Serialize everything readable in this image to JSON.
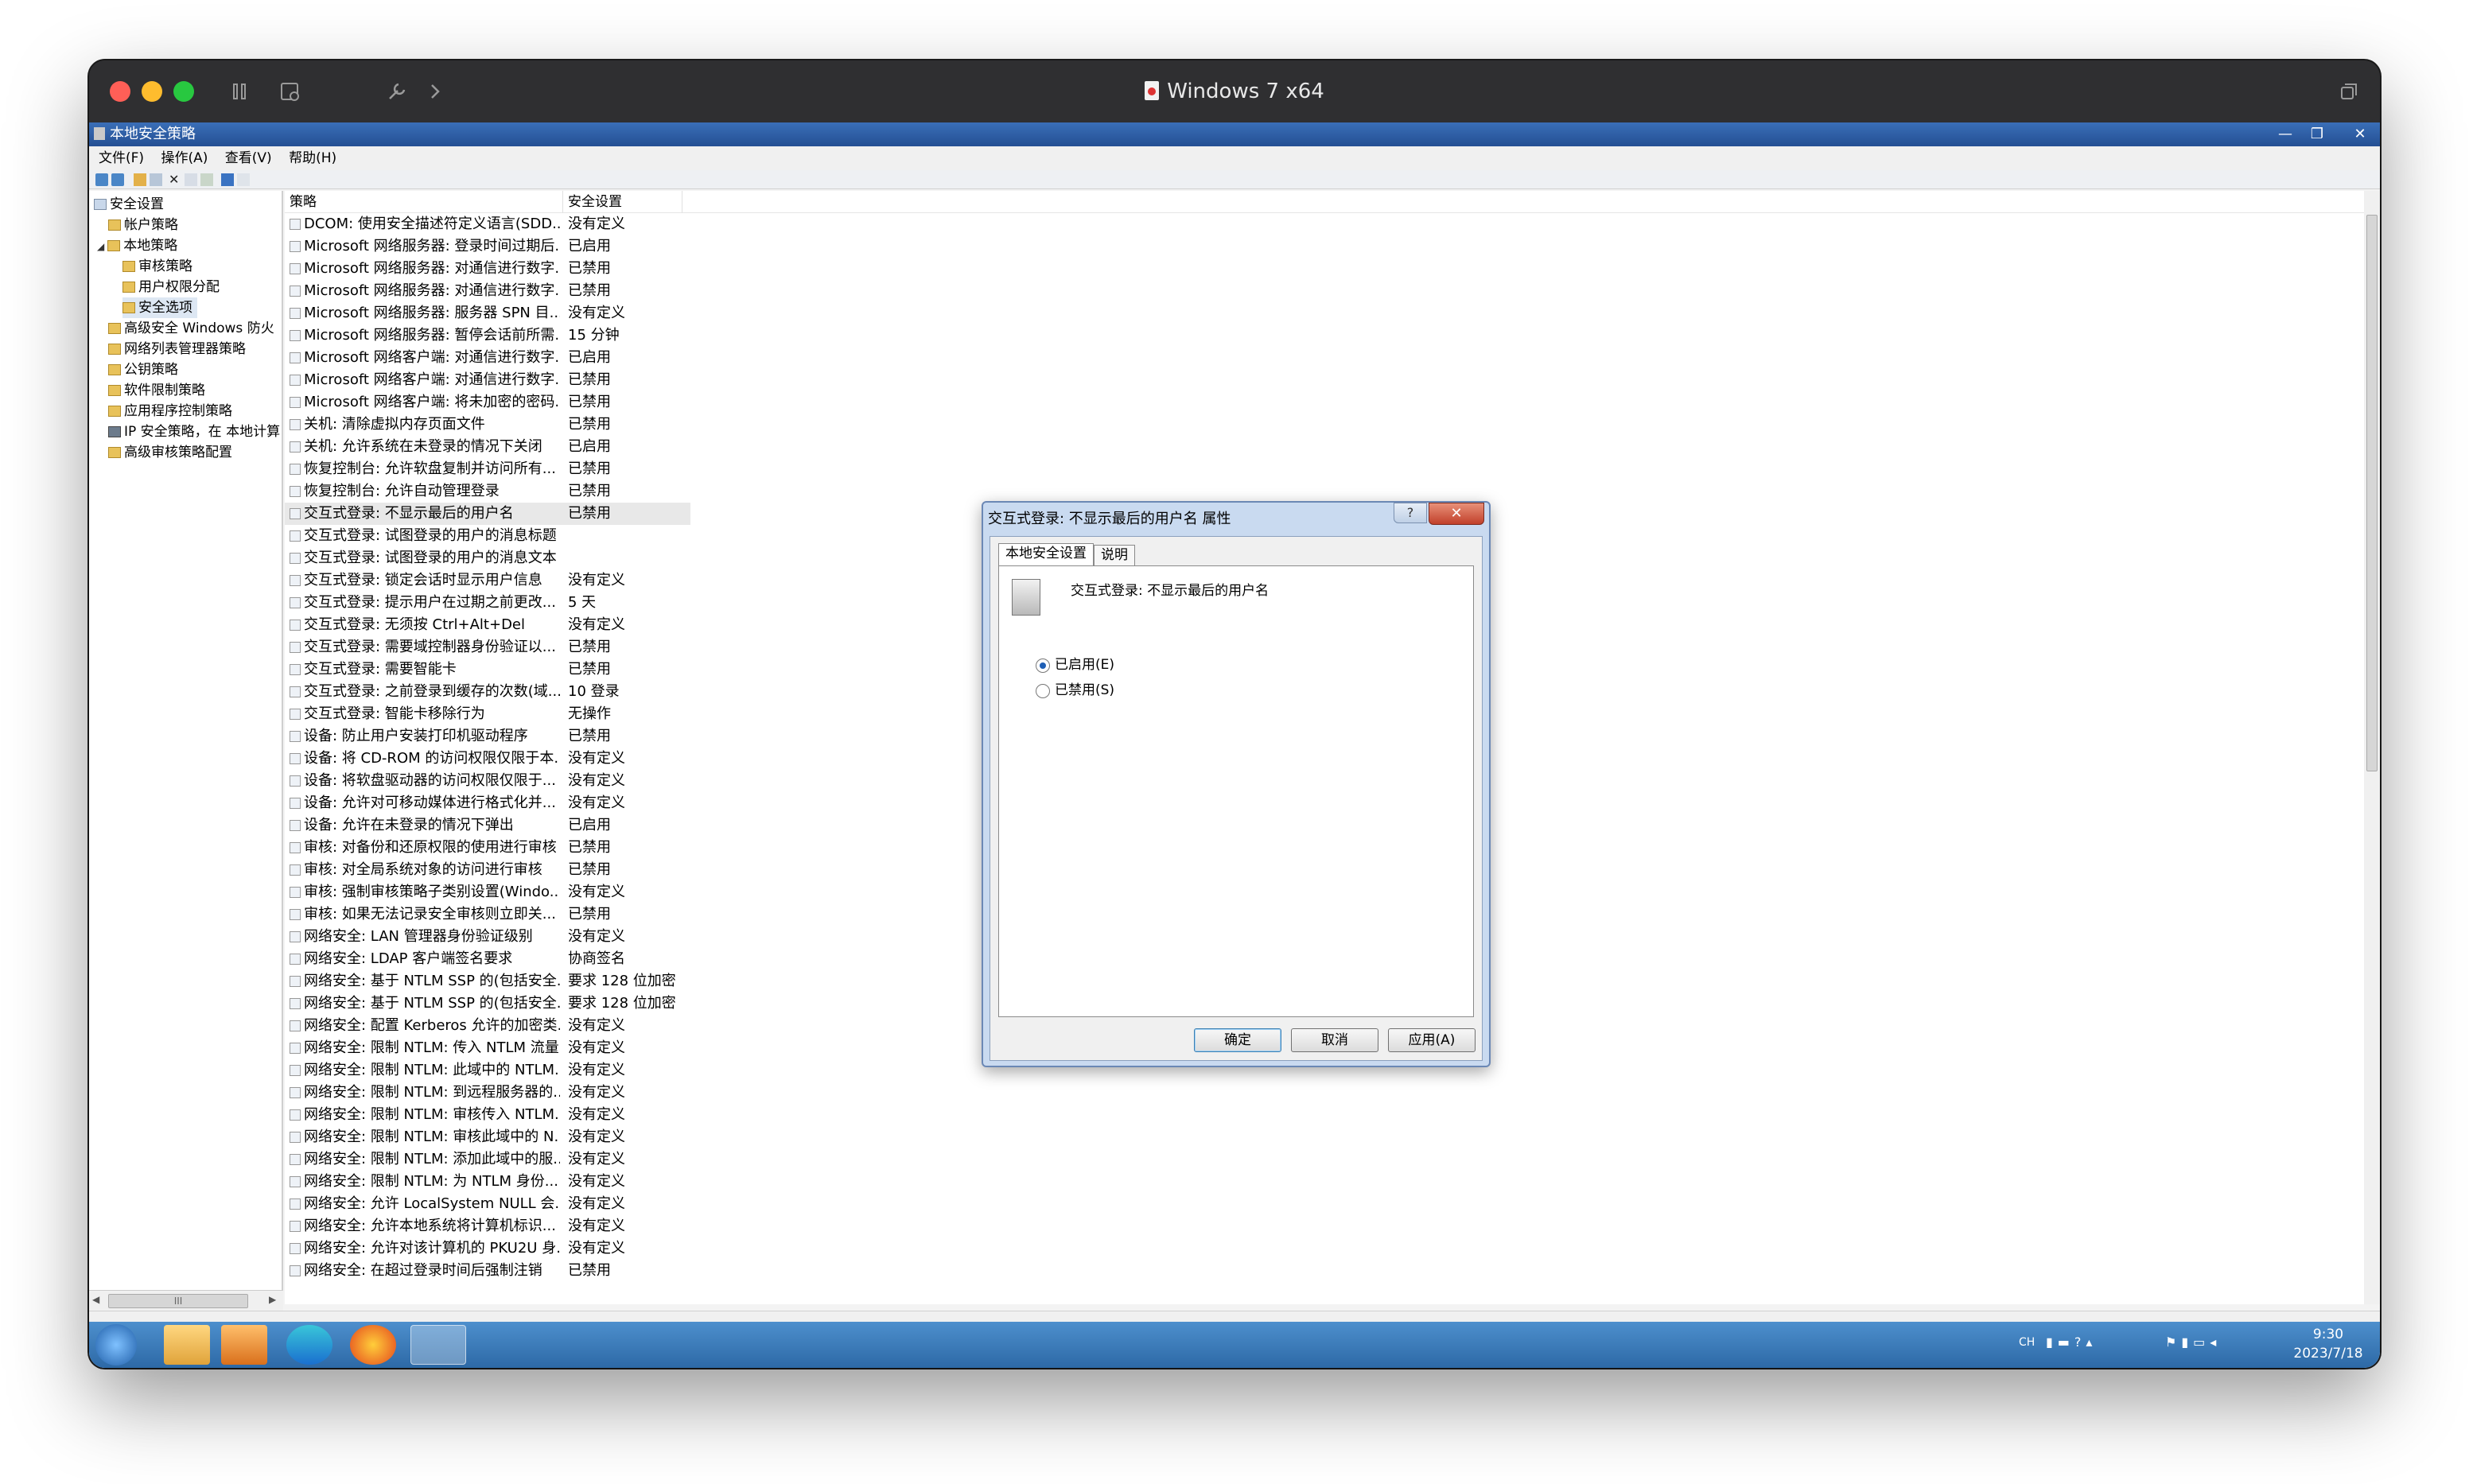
{
  "mac_window": {
    "title": "Windows 7 x64",
    "traffic_colors": {
      "close": "#ff5f57",
      "minimize": "#febc2e",
      "maximize": "#28c840"
    },
    "toolbar_icons": [
      "pause-icon",
      "snapshot-icon",
      "wrench-icon",
      "chevron-right-icon"
    ],
    "restore_icon": "restore-window-icon"
  },
  "app": {
    "title": "本地安全策略",
    "menu": [
      "文件(F)",
      "操作(A)",
      "查看(V)",
      "帮助(H)"
    ],
    "caption_buttons": {
      "minimize": "—",
      "restore": "❐",
      "close": "✕"
    }
  },
  "tree": {
    "items": [
      {
        "label": "安全设置",
        "level": 0
      },
      {
        "label": "帐户策略",
        "level": 1
      },
      {
        "label": "本地策略",
        "level": 1
      },
      {
        "label": "审核策略",
        "level": 2
      },
      {
        "label": "用户权限分配",
        "level": 2
      },
      {
        "label": "安全选项",
        "level": 2
      },
      {
        "label": "高级安全 Windows 防火",
        "level": 1
      },
      {
        "label": "网络列表管理器策略",
        "level": 1
      },
      {
        "label": "公钥策略",
        "level": 1
      },
      {
        "label": "软件限制策略",
        "level": 1
      },
      {
        "label": "应用程序控制策略",
        "level": 1
      },
      {
        "label": "IP 安全策略，在 本地计算",
        "level": 1
      },
      {
        "label": "高级审核策略配置",
        "level": 1
      }
    ],
    "scroll_label": "III"
  },
  "list": {
    "columns": {
      "policy": "策略",
      "setting": "安全设置"
    },
    "rows": [
      {
        "policy": "DCOM: 使用安全描述符定义语言(SDD...",
        "setting": "没有定义"
      },
      {
        "policy": "Microsoft 网络服务器: 登录时间过期后...",
        "setting": "已启用"
      },
      {
        "policy": "Microsoft 网络服务器: 对通信进行数字...",
        "setting": "已禁用"
      },
      {
        "policy": "Microsoft 网络服务器: 对通信进行数字...",
        "setting": "已禁用"
      },
      {
        "policy": "Microsoft 网络服务器: 服务器 SPN 目...",
        "setting": "没有定义"
      },
      {
        "policy": "Microsoft 网络服务器: 暂停会话前所需...",
        "setting": "15 分钟"
      },
      {
        "policy": "Microsoft 网络客户端: 对通信进行数字...",
        "setting": "已启用"
      },
      {
        "policy": "Microsoft 网络客户端: 对通信进行数字...",
        "setting": "已禁用"
      },
      {
        "policy": "Microsoft 网络客户端: 将未加密的密码...",
        "setting": "已禁用"
      },
      {
        "policy": "关机: 清除虚拟内存页面文件",
        "setting": "已禁用"
      },
      {
        "policy": "关机: 允许系统在未登录的情况下关闭",
        "setting": "已启用"
      },
      {
        "policy": "恢复控制台: 允许软盘复制并访问所有...",
        "setting": "已禁用"
      },
      {
        "policy": "恢复控制台: 允许自动管理登录",
        "setting": "已禁用"
      },
      {
        "policy": "交互式登录: 不显示最后的用户名",
        "setting": "已禁用"
      },
      {
        "policy": "交互式登录: 试图登录的用户的消息标题",
        "setting": ""
      },
      {
        "policy": "交互式登录: 试图登录的用户的消息文本",
        "setting": ""
      },
      {
        "policy": "交互式登录: 锁定会话时显示用户信息",
        "setting": "没有定义"
      },
      {
        "policy": "交互式登录: 提示用户在过期之前更改...",
        "setting": "5 天"
      },
      {
        "policy": "交互式登录: 无须按 Ctrl+Alt+Del",
        "setting": "没有定义"
      },
      {
        "policy": "交互式登录: 需要域控制器身份验证以...",
        "setting": "已禁用"
      },
      {
        "policy": "交互式登录: 需要智能卡",
        "setting": "已禁用"
      },
      {
        "policy": "交互式登录: 之前登录到缓存的次数(域...",
        "setting": "10 登录"
      },
      {
        "policy": "交互式登录: 智能卡移除行为",
        "setting": "无操作"
      },
      {
        "policy": "设备: 防止用户安装打印机驱动程序",
        "setting": "已禁用"
      },
      {
        "policy": "设备: 将 CD-ROM 的访问权限仅限于本...",
        "setting": "没有定义"
      },
      {
        "policy": "设备: 将软盘驱动器的访问权限仅限于...",
        "setting": "没有定义"
      },
      {
        "policy": "设备: 允许对可移动媒体进行格式化并...",
        "setting": "没有定义"
      },
      {
        "policy": "设备: 允许在未登录的情况下弹出",
        "setting": "已启用"
      },
      {
        "policy": "审核: 对备份和还原权限的使用进行审核",
        "setting": "已禁用"
      },
      {
        "policy": "审核: 对全局系统对象的访问进行审核",
        "setting": "已禁用"
      },
      {
        "policy": "审核: 强制审核策略子类别设置(Windo...",
        "setting": "没有定义"
      },
      {
        "policy": "审核: 如果无法记录安全审核则立即关...",
        "setting": "已禁用"
      },
      {
        "policy": "网络安全: LAN 管理器身份验证级别",
        "setting": "没有定义"
      },
      {
        "policy": "网络安全: LDAP 客户端签名要求",
        "setting": "协商签名"
      },
      {
        "policy": "网络安全: 基于 NTLM SSP 的(包括安全...",
        "setting": "要求 128 位加密"
      },
      {
        "policy": "网络安全: 基于 NTLM SSP 的(包括安全...",
        "setting": "要求 128 位加密"
      },
      {
        "policy": "网络安全: 配置 Kerberos 允许的加密类...",
        "setting": "没有定义"
      },
      {
        "policy": "网络安全: 限制 NTLM: 传入 NTLM 流量",
        "setting": "没有定义"
      },
      {
        "policy": "网络安全: 限制 NTLM: 此域中的 NTLM...",
        "setting": "没有定义"
      },
      {
        "policy": "网络安全: 限制 NTLM: 到远程服务器的...",
        "setting": "没有定义"
      },
      {
        "policy": "网络安全: 限制 NTLM: 审核传入 NTLM...",
        "setting": "没有定义"
      },
      {
        "policy": "网络安全: 限制 NTLM: 审核此域中的 N...",
        "setting": "没有定义"
      },
      {
        "policy": "网络安全: 限制 NTLM: 添加此域中的服...",
        "setting": "没有定义"
      },
      {
        "policy": "网络安全: 限制 NTLM: 为 NTLM 身份...",
        "setting": "没有定义"
      },
      {
        "policy": "网络安全: 允许 LocalSystem NULL 会...",
        "setting": "没有定义"
      },
      {
        "policy": "网络安全: 允许本地系统将计算机标识...",
        "setting": "没有定义"
      },
      {
        "policy": "网络安全: 允许对该计算机的 PKU2U 身...",
        "setting": "没有定义"
      },
      {
        "policy": "网络安全: 在超过登录时间后强制注销",
        "setting": "已禁用"
      }
    ]
  },
  "dialog": {
    "title": "交互式登录: 不显示最后的用户名 属性",
    "help": "?",
    "close": "✕",
    "tabs": [
      "本地安全设置",
      "说明"
    ],
    "policy_name": "交互式登录: 不显示最后的用户名",
    "options": [
      {
        "label": "已启用(E)",
        "checked": true
      },
      {
        "label": "已禁用(S)",
        "checked": false
      }
    ],
    "buttons": {
      "ok": "确定",
      "cancel": "取消",
      "apply": "应用(A)"
    }
  },
  "taskbar": {
    "apps": [
      "start-orb",
      "explorer-icon",
      "media-player-icon",
      "edge-icon",
      "firefox-icon",
      "security-policy-icon"
    ],
    "tray_lang": "CH",
    "time": "9:30",
    "date": "2023/7/18"
  }
}
